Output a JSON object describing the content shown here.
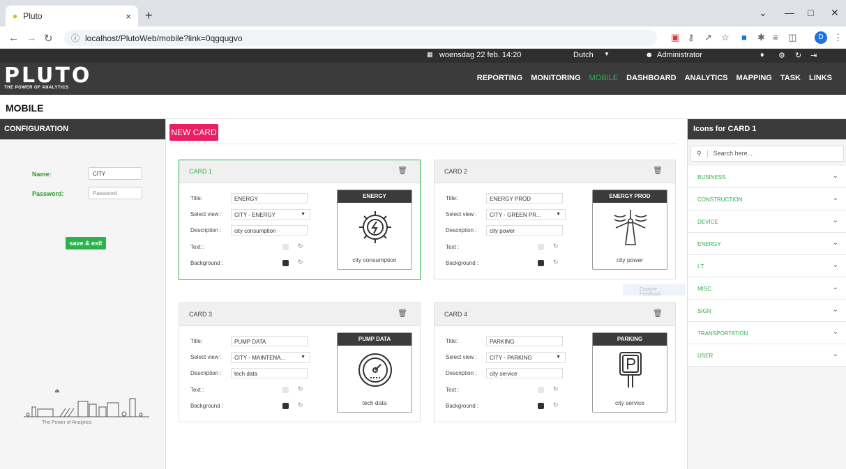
{
  "browser": {
    "tab_title": "Pluto",
    "tab_close": "×",
    "new_tab": "+",
    "url": "localhost/PlutoWeb/mobile?link=0qgqugvo",
    "profile_initial": "D"
  },
  "topbar": {
    "datetime": "woensdag 22 feb. 14:20",
    "language": "Dutch",
    "user": "Administrator"
  },
  "app": {
    "logo": "PLUTO",
    "tagline": "THE POWER OF ANALYTICS",
    "menu": [
      "REPORTING",
      "MONITORING",
      "MOBILE",
      "DASHBOARD",
      "ANALYTICS",
      "MAPPING",
      "TASK",
      "LINKS"
    ],
    "active_menu": "MOBILE",
    "page_title": "MOBILE"
  },
  "config": {
    "header": "CONFIGURATION",
    "name_label": "Name:",
    "name_value": "CITY",
    "password_label": "Password:",
    "password_placeholder": "Password",
    "save_label": "save & exit",
    "footer_caption": "The Power of Analytics"
  },
  "main": {
    "new_card_label": "NEW CARD",
    "tooltip": "Capture Feedback",
    "field_labels": {
      "title": "Title:",
      "select_view": "Select view :",
      "description": "Description :",
      "text": "Text :",
      "background": "Background :"
    },
    "cards": [
      {
        "header": "CARD 1",
        "title": "ENERGY",
        "view": "CITY - ENERGY",
        "description": "city consumption",
        "preview_title": "ENERGY",
        "preview_desc": "city consumption",
        "icon": "energy-gear-icon",
        "selected": true
      },
      {
        "header": "CARD 2",
        "title": "ENERGY PROD",
        "view": "CITY - GREEN PR...",
        "description": "city power",
        "preview_title": "ENERGY PROD",
        "preview_desc": "city power",
        "icon": "wind-turbine-icon",
        "selected": false
      },
      {
        "header": "CARD 3",
        "title": "PUMP DATA",
        "view": "CITY - MAINTENA...",
        "description": "tech data",
        "preview_title": "PUMP DATA",
        "preview_desc": "tech data",
        "icon": "gauge-icon",
        "selected": false
      },
      {
        "header": "CARD 4",
        "title": "PARKING",
        "view": "CITY - PARKING",
        "description": "city service",
        "preview_title": "PARKING",
        "preview_desc": "city service",
        "icon": "parking-sign-icon",
        "selected": false
      }
    ]
  },
  "icons_panel": {
    "header": "Icons for CARD 1",
    "search_placeholder": "Search here...",
    "categories": [
      "BUSINESS",
      "CONSTRUCTION",
      "DEVICE",
      "ENERGY",
      "I.T",
      "MISC",
      "SIGN",
      "TRANSPORTATION",
      "USER"
    ]
  },
  "colors": {
    "accent_green": "#2bb24c",
    "new_card_pink": "#e91e63",
    "header_dark": "#3b3b3b"
  }
}
